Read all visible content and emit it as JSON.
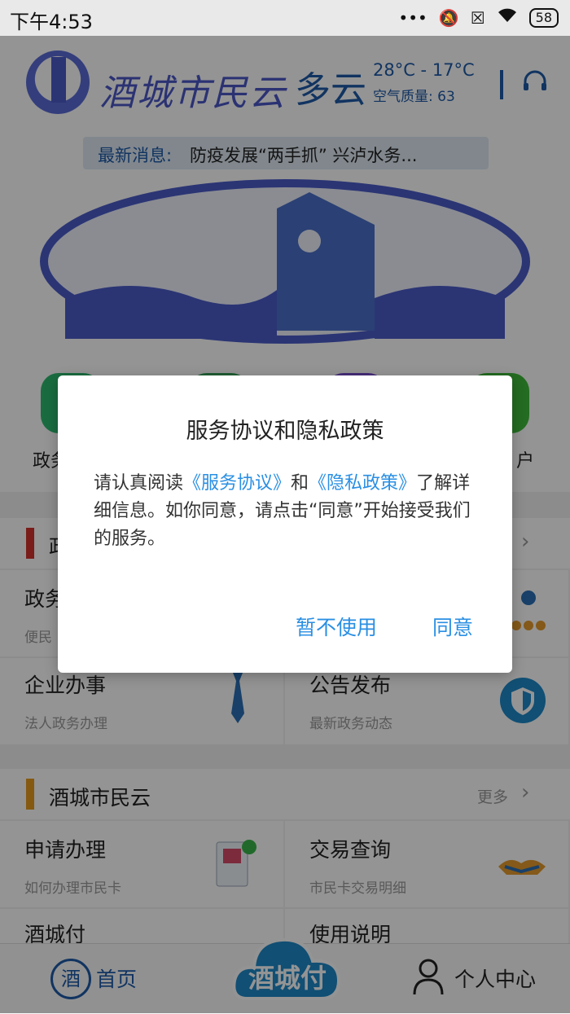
{
  "status_bar": {
    "time": "下午4:53",
    "battery": "58"
  },
  "header": {
    "app_name": "酒城市民云",
    "weather": "多云",
    "temperature": "28°C - 17°C",
    "air_quality": "空气质量: 63"
  },
  "news": {
    "label": "最新消息:",
    "text": "防疫发展“两手抓” 兴泸水务..."
  },
  "icon_row": {
    "labels": [
      "政务",
      "户"
    ],
    "colors": [
      "#2dbb6e",
      "#3aa35a",
      "#7b4fd0",
      "#3ebb3a"
    ]
  },
  "section1": {
    "title": "政",
    "bar_color": "#d0312d",
    "cells": [
      {
        "title": "政务",
        "sub": "便民"
      },
      {
        "title": "企业办事",
        "sub": "法人政务办理"
      },
      {
        "title": "公告发布",
        "sub": "最新政务动态"
      }
    ]
  },
  "section2": {
    "title": "酒城市民云",
    "bar_color": "#e69a1c",
    "more": "更多",
    "cells": [
      {
        "title": "申请办理",
        "sub": "如何办理市民卡"
      },
      {
        "title": "交易查询",
        "sub": "市民卡交易明细"
      },
      {
        "title": "酒城付",
        "sub": ""
      },
      {
        "title": "使用说明",
        "sub": ""
      }
    ]
  },
  "bottom_nav": {
    "home_icon": "酒",
    "home": "首页",
    "center": "酒城付",
    "me": "个人中心"
  },
  "dialog": {
    "title": "服务协议和隐私政策",
    "body_prefix": "请认真阅读",
    "link_service": "《服务协议》",
    "body_and": "和",
    "link_privacy": "《隐私政策》",
    "body_suffix": "了解详细信息。如你同意，请点击“同意”开始接受我们的服务。",
    "cancel": "暂不使用",
    "agree": "同意"
  },
  "colors": {
    "accent": "#2a8fe3",
    "brand": "#1e5aa8"
  }
}
